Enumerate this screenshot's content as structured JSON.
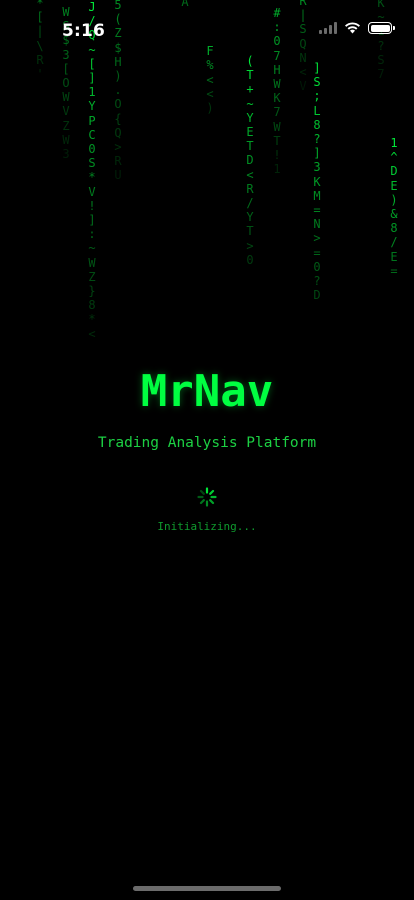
{
  "status_bar": {
    "time": "5:16"
  },
  "app": {
    "title": "MrNav",
    "subtitle": "Trading Analysis Platform",
    "status": "Initializing..."
  },
  "colors": {
    "background": "#000000",
    "accent": "#00ff41",
    "subtitle": "#1cd043",
    "status": "#0f9a2e"
  },
  "matrix_rain": {
    "columns": [
      {
        "chars": [
          "*",
          "[",
          "|",
          "\\",
          "R",
          "'"
        ]
      },
      {
        "chars": [
          "W",
          "S",
          "$",
          "3",
          "[",
          "O",
          "W",
          "V",
          "Z",
          "W",
          "3"
        ]
      },
      {
        "chars": [
          "J",
          "/",
          "Q",
          "~",
          "[",
          "]",
          "1",
          "Y",
          "P",
          "C",
          "0",
          "S",
          "*",
          "V",
          "!",
          "]",
          ":",
          "~",
          "W",
          "Z",
          "}",
          "8",
          "*",
          "<"
        ]
      },
      {
        "chars": [
          "5",
          "(",
          "Z",
          "$",
          "H",
          ")",
          ".",
          "O",
          "{",
          "Q",
          ">",
          "R",
          "U"
        ]
      },
      {
        "chars": [
          "A"
        ]
      },
      {
        "chars": [
          "\"",
          "F",
          "%",
          "<",
          "<",
          ")"
        ]
      },
      {
        "chars": [
          "(",
          "T",
          "+",
          "~",
          "Y",
          "E",
          "T",
          "D",
          "<",
          "R",
          "/",
          "Y",
          "T",
          ">",
          "0"
        ]
      },
      {
        "chars": [
          "#",
          ":",
          "0",
          "7",
          "H",
          "W",
          "K",
          "7",
          "W",
          "T",
          "!",
          "1"
        ]
      },
      {
        "chars": [
          "R",
          "|",
          "S",
          "Q",
          "N",
          "<",
          "V"
        ]
      },
      {
        "chars": [
          "]",
          "S",
          ";",
          "L",
          "8",
          "?",
          "]",
          "3",
          "K",
          "M",
          "=",
          "N",
          ">",
          "=",
          "0",
          "?",
          "D"
        ]
      },
      {
        "chars": [
          "K",
          "~",
          "1",
          "?",
          "S",
          "7"
        ]
      },
      {
        "chars": [
          "1",
          "^",
          "D",
          "E",
          ")",
          "&",
          "8",
          "/",
          "E",
          "="
        ]
      }
    ]
  }
}
